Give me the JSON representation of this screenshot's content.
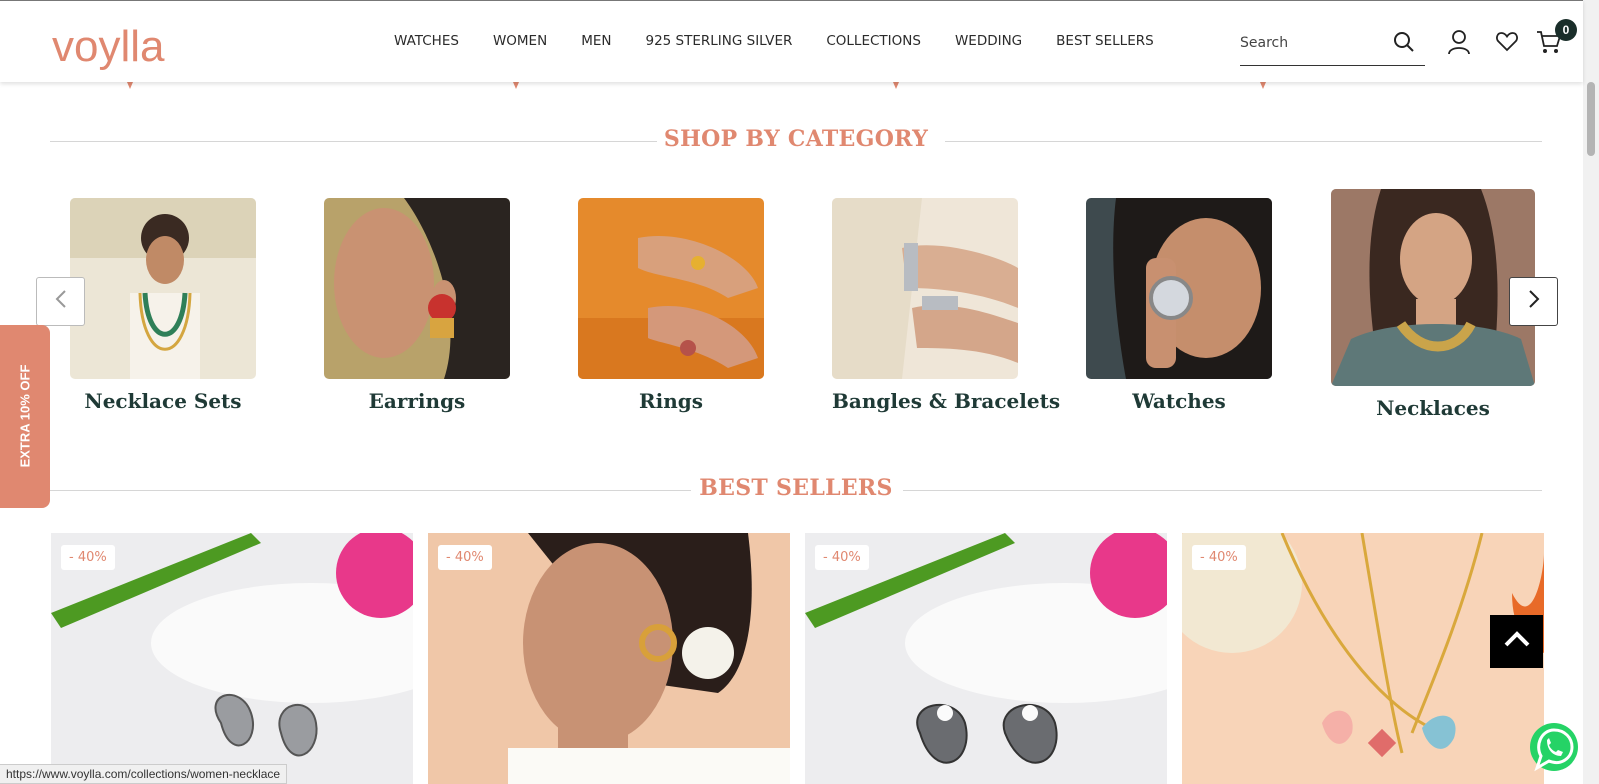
{
  "header": {
    "logo": "voylla",
    "nav": [
      "WATCHES",
      "WOMEN",
      "MEN",
      "925 STERLING SILVER",
      "COLLECTIONS",
      "WEDDING",
      "BEST SELLERS"
    ],
    "search_placeholder": "Search",
    "cart_count": "0",
    "icons": [
      "search-icon",
      "user-icon",
      "heart-icon",
      "cart-icon"
    ]
  },
  "shop_by_category": {
    "title": "SHOP BY CATEGORY",
    "items": [
      {
        "label": "Necklace Sets"
      },
      {
        "label": "Earrings"
      },
      {
        "label": "Rings"
      },
      {
        "label": "Bangles & Bracelets"
      },
      {
        "label": "Watches"
      },
      {
        "label": "Necklaces"
      }
    ]
  },
  "side_tab": "EXTRA 10% OFF",
  "best_sellers": {
    "title": "BEST SELLERS",
    "products": [
      {
        "discount": "- 40%"
      },
      {
        "discount": "- 40%"
      },
      {
        "discount": "- 40%"
      },
      {
        "discount": "- 40%"
      }
    ]
  },
  "status_url": "https://www.voylla.com/collections/women-necklace",
  "colors": {
    "accent": "#e08870",
    "heading_dark": "#1f3a36"
  }
}
